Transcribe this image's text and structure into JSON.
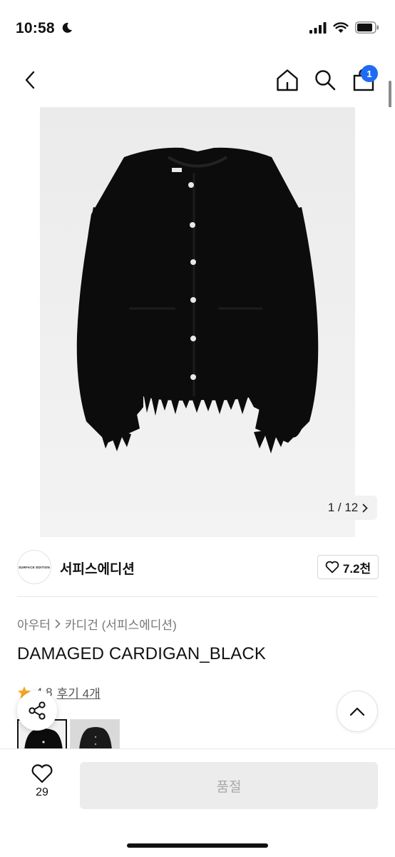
{
  "status": {
    "time": "10:58",
    "icons": [
      "moon-icon",
      "signal-icon",
      "wifi-icon",
      "battery-icon"
    ]
  },
  "nav": {
    "icons": [
      "back-icon",
      "home-icon",
      "search-icon",
      "bag-icon"
    ],
    "cart_badge": "1",
    "badge_color": "#1f6cf3"
  },
  "gallery": {
    "pager_text": "1 / 12",
    "pager_icon": "chevron-right-icon"
  },
  "brand": {
    "logo_text": "SURFACE EDITION",
    "name": "서피스에디션",
    "like_count": "7.2천"
  },
  "product": {
    "breadcrumb": [
      "아우터",
      "카디건 (서피스에디션)"
    ],
    "title": "DAMAGED CARDIGAN_BLACK",
    "rating": "4.8",
    "review_link": "후기 4개",
    "star_color": "#f5a623"
  },
  "bottom": {
    "wish_count": "29",
    "soldout_label": "품절"
  }
}
